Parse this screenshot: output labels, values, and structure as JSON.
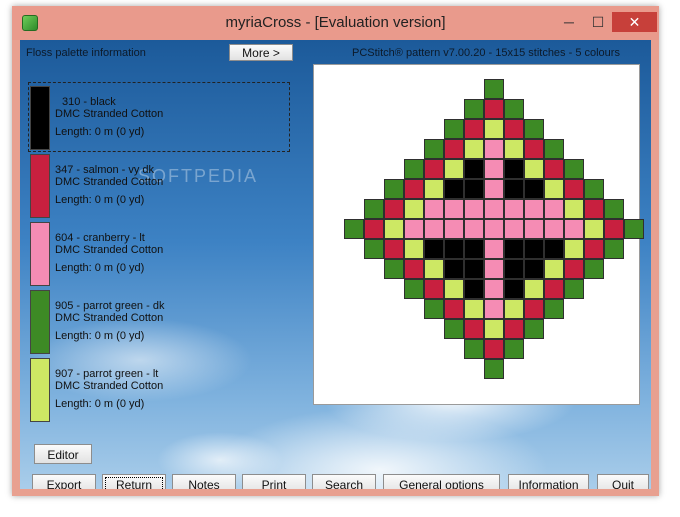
{
  "window": {
    "title": "myriaCross - [Evaluation version]"
  },
  "titlebar_buttons": {
    "minimize": "─",
    "maximize": "☐",
    "close": "✕"
  },
  "panel": {
    "title": "Floss palette information",
    "more_button": "More >"
  },
  "pattern_info": "PCStitch® pattern v7.00.20 - 15x15 stitches - 5 colours",
  "flosses": [
    {
      "name": "310 - black",
      "brand": "DMC Stranded Cotton",
      "length": "Length: 0 m (0 yd)",
      "color": "#000000"
    },
    {
      "name": "347 - salmon - vy dk",
      "brand": "DMC Stranded Cotton",
      "length": "Length: 0 m (0 yd)",
      "color": "#c8203f"
    },
    {
      "name": "604 - cranberry - lt",
      "brand": "DMC Stranded Cotton",
      "length": "Length: 0 m (0 yd)",
      "color": "#f58cb4"
    },
    {
      "name": "905 - parrot green - dk",
      "brand": "DMC Stranded Cotton",
      "length": "Length: 0 m (0 yd)",
      "color": "#3d8a25"
    },
    {
      "name": "907 - parrot green - lt",
      "brand": "DMC Stranded Cotton",
      "length": "Length: 0 m (0 yd)",
      "color": "#cde864"
    }
  ],
  "palette_colors": {
    "K": "#000000",
    "R": "#c8203f",
    "P": "#f58cb4",
    "G": "#3d8a25",
    "L": "#cde864"
  },
  "pattern_rows": [
    ".......G.......",
    "......GRG......",
    ".....GRLRG.....",
    "....GRLPLRG....",
    "...GRLKPKLRG...",
    "..GRLKKPKKLRG..",
    ".GRLPPPPPPPLRG.",
    "GRLPPPPPPPPPLRG",
    ".GRLKKKPKKKLRG.",
    "..GRLKKPKKLRG..",
    "...GRLKPKLRG...",
    "....GRLPLRG....",
    ".....GRLRG.....",
    "......GRG......",
    ".......G......."
  ],
  "buttons": {
    "editor": "Editor",
    "export": "Export",
    "return": "Return",
    "notes": "Notes",
    "print": "Print",
    "search": "Search",
    "general_options": "General options",
    "information": "Information",
    "quit": "Quit"
  },
  "watermark": "SOFTPEDIA"
}
